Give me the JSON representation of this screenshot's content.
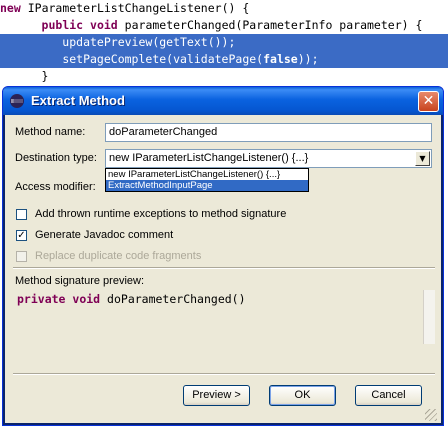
{
  "editor": {
    "lines": [
      "new IParameterListChangeListener() {",
      "      public void parameterChanged(ParameterInfo parameter) {",
      "         updatePreview(getText());",
      "         setPageComplete(validatePage(false));",
      "      }"
    ]
  },
  "dialog": {
    "title": "Extract Method",
    "close_glyph": "✕",
    "method_name_label": "Method name:",
    "method_name_value": "doParameterChanged",
    "destination_label": "Destination type:",
    "destination_value": "new IParameterListChangeListener() {...}",
    "destination_options": [
      "new IParameterListChangeListener() {...}",
      "ExtractMethodInputPage"
    ],
    "access_label": "Access modifier:",
    "checkbox_thrown_label": "Add thrown runtime exceptions to method signature",
    "checkbox_thrown_checked": false,
    "checkbox_javadoc_label": "Generate Javadoc comment",
    "checkbox_javadoc_checked": true,
    "checkbox_replace_label": "Replace duplicate code fragments",
    "checkbox_replace_checked": false,
    "signature_label": "Method signature preview:",
    "signature_keyword1": "private",
    "signature_keyword2": "void",
    "signature_rest": "doParameterChanged()",
    "buttons": {
      "preview": "Preview >",
      "ok": "OK",
      "cancel": "Cancel"
    }
  },
  "colors": {
    "selection": "#3b6bc5",
    "keyword": "#7f0055",
    "titlebar": "#0a62e0"
  }
}
